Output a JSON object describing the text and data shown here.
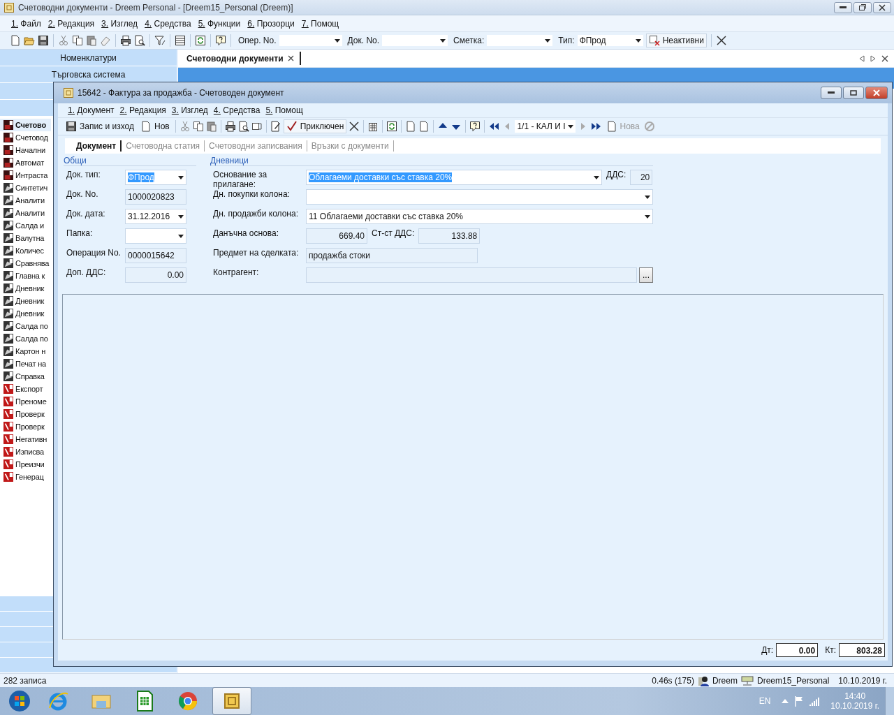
{
  "window": {
    "title": "Счетоводни документи - Dreem Personal - [Dreem15_Personal (Dreem)]"
  },
  "menu": [
    "1. Файл",
    "2. Редакция",
    "3. Изглед",
    "4. Средства",
    "5. Функции",
    "6. Прозорци",
    "7. Помощ"
  ],
  "toolbar": {
    "filters": [
      {
        "label": "Опер. No."
      },
      {
        "label": "Док. No."
      },
      {
        "label": "Сметка:"
      },
      {
        "label": "Тип:",
        "value": "ФПрод"
      }
    ],
    "inactive_button": "Неактивни"
  },
  "sidebar": {
    "nav": [
      "Номенклатури",
      "Търговска система"
    ],
    "items": [
      {
        "label": "Счетово",
        "kind": "ledger",
        "selected": true
      },
      {
        "label": "Счетовод",
        "kind": "ledger",
        "selected": false
      },
      {
        "label": "Начални",
        "kind": "ledger",
        "selected": false
      },
      {
        "label": "Автомат",
        "kind": "ledger",
        "selected": false
      },
      {
        "label": "Интраста",
        "kind": "ledger",
        "selected": false
      },
      {
        "label": "Синтетич",
        "kind": "report",
        "selected": false
      },
      {
        "label": "Аналити",
        "kind": "report",
        "selected": false
      },
      {
        "label": "Аналити",
        "kind": "report",
        "selected": false
      },
      {
        "label": "Салда и",
        "kind": "report",
        "selected": false
      },
      {
        "label": "Валутна",
        "kind": "report",
        "selected": false
      },
      {
        "label": "Количес",
        "kind": "report",
        "selected": false
      },
      {
        "label": "Сравнява",
        "kind": "report",
        "selected": false
      },
      {
        "label": "Главна к",
        "kind": "report",
        "selected": false
      },
      {
        "label": "Дневник",
        "kind": "report",
        "selected": false
      },
      {
        "label": "Дневник",
        "kind": "report",
        "selected": false
      },
      {
        "label": "Дневник",
        "kind": "report",
        "selected": false
      },
      {
        "label": "Салда по",
        "kind": "report",
        "selected": false
      },
      {
        "label": "Салда по",
        "kind": "report",
        "selected": false
      },
      {
        "label": "Картон н",
        "kind": "report",
        "selected": false
      },
      {
        "label": "Печат на",
        "kind": "report",
        "selected": false
      },
      {
        "label": "Справка",
        "kind": "report",
        "selected": false
      },
      {
        "label": "Експорт",
        "kind": "function",
        "selected": false
      },
      {
        "label": "Преноме",
        "kind": "function",
        "selected": false
      },
      {
        "label": "Проверк",
        "kind": "function",
        "selected": false
      },
      {
        "label": "Проверк",
        "kind": "function",
        "selected": false
      },
      {
        "label": "Негативн",
        "kind": "function",
        "selected": false
      },
      {
        "label": "Изписва",
        "kind": "function",
        "selected": false
      },
      {
        "label": "Преизчи",
        "kind": "function",
        "selected": false
      },
      {
        "label": "Генерац",
        "kind": "function",
        "selected": false
      }
    ]
  },
  "document_tab": {
    "label": "Счетоводни документи"
  },
  "dialog": {
    "title": "15642 - Фактура за продажба - Счетоводен документ",
    "menu": [
      "1. Документ",
      "2. Редакция",
      "3. Изглед",
      "4. Средства",
      "5. Помощ"
    ],
    "toolbar": {
      "save_exit": "Запис и изход",
      "new": "Нов",
      "finished": "Приключен",
      "record": "1/1 - КАЛ И I",
      "new_record": {
        "label": "Нова",
        "disabled": true
      }
    },
    "tabs": [
      {
        "label": "Документ",
        "selected": true
      },
      {
        "label": "Счетоводна статия",
        "selected": false
      },
      {
        "label": "Счетоводни записвания",
        "selected": false
      },
      {
        "label": "Връзки с документи",
        "selected": false
      }
    ],
    "general": {
      "title": "Общи",
      "fields": [
        {
          "label": "Док. тип:",
          "kind": "dropdown",
          "value": "ФПрод",
          "text_selected": true
        },
        {
          "label": "Док. No.",
          "kind": "text",
          "value": "1000020823",
          "text_selected": false
        },
        {
          "label": "Док. дата:",
          "kind": "dropdown",
          "value": "31.12.2016",
          "text_selected": false
        },
        {
          "label": "Папка:",
          "kind": "dropdown"
        },
        {
          "label": "Операция No.",
          "kind": "text",
          "value": "0000015642",
          "text_selected": false
        },
        {
          "label": "Доп. ДДС:",
          "kind": "number",
          "value": "0.00",
          "text_selected": false
        }
      ]
    },
    "journals": {
      "title": "Дневници",
      "fields": [
        {
          "label": "Основание за прилагане:",
          "kind": "dropdown",
          "value": "Облагаеми доставки със ставка 20%",
          "text_selected": true,
          "extra": {
            "label": "ДДС:",
            "kind": "number",
            "value": "20"
          }
        },
        {
          "label": "Дн. покупки колона:",
          "kind": "dropdown"
        },
        {
          "label": "Дн. продажби колона:",
          "kind": "dropdown",
          "value": "11 Облагаеми доставки със ставка 20%",
          "text_selected": false
        },
        {
          "label": "Данъчна основа:",
          "kind": "number",
          "value": "669.40",
          "text_selected": false,
          "extra": {
            "label": "Ст-ст ДДС:",
            "kind": "number",
            "value": "133.88"
          }
        },
        {
          "label": "Предмет на сделката:",
          "kind": "text",
          "value": "продажба стоки",
          "text_selected": false
        },
        {
          "label": "Контрагент:",
          "kind": "browse",
          "button": "..."
        }
      ]
    },
    "totals": [
      {
        "label": "Дт:",
        "value": "0.00"
      },
      {
        "label": "Кт:",
        "value": "803.28"
      }
    ]
  },
  "status_bar": {
    "records": "282 записа",
    "timing": "0.46s (175)",
    "user": "Dreem",
    "database": "Dreem15_Personal",
    "date": "10.10.2019 г."
  },
  "taskbar": {
    "apps": [
      {
        "selected": false
      },
      {
        "selected": false
      },
      {
        "selected": false
      },
      {
        "selected": false
      },
      {
        "selected": false
      },
      {
        "selected": true
      }
    ],
    "language": "EN",
    "time": "14:40",
    "date": "10.10.2019 г."
  }
}
